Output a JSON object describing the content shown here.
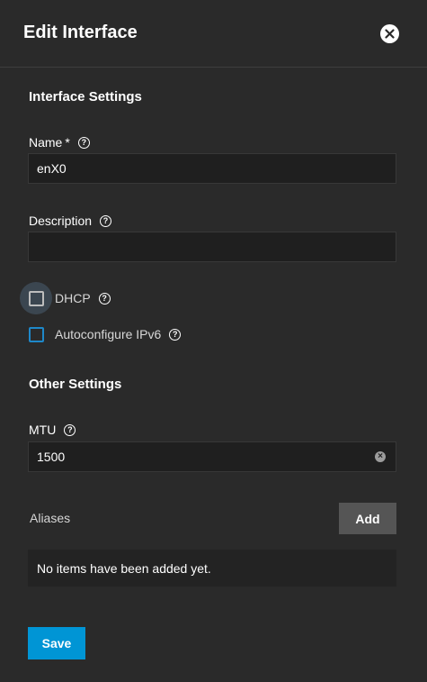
{
  "header": {
    "title": "Edit Interface",
    "close_icon": "close-icon"
  },
  "interface_settings": {
    "title": "Interface Settings",
    "name": {
      "label": "Name",
      "required_mark": "*",
      "value": "enX0"
    },
    "description": {
      "label": "Description",
      "value": ""
    },
    "dhcp": {
      "label": "DHCP",
      "checked": false
    },
    "autoconfigure": {
      "label": "Autoconfigure IPv6",
      "checked": false
    }
  },
  "other_settings": {
    "title": "Other Settings",
    "mtu": {
      "label": "MTU",
      "value": "1500"
    }
  },
  "aliases": {
    "label": "Aliases",
    "add_label": "Add",
    "empty_text": "No items have been added yet."
  },
  "actions": {
    "save_label": "Save"
  },
  "colors": {
    "accent": "#0095d5",
    "background": "#2a2a2a",
    "input_bg": "#1f1f1f",
    "checkbox_blue": "#1e88c9"
  },
  "icons": {
    "help": "help-circle-icon",
    "clear": "clear-circle-icon"
  }
}
